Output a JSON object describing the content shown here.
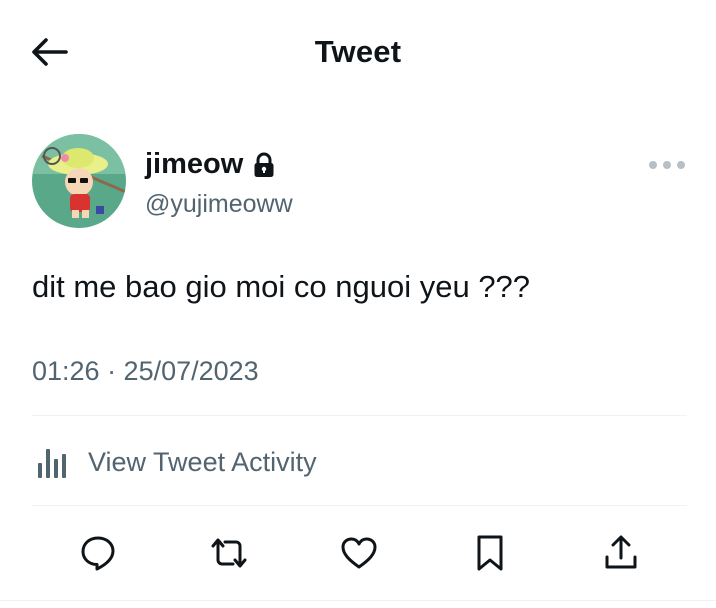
{
  "header": {
    "title": "Tweet",
    "back_icon": "arrow-left-icon"
  },
  "author": {
    "display_name": "jimeow",
    "handle": "@yujimeoww",
    "protected_icon": "lock-icon",
    "more_icon": "more-horizontal-icon"
  },
  "tweet": {
    "text": "dit me bao gio moi co nguoi yeu ???",
    "timestamp": "01:26 · 25/07/2023"
  },
  "activity": {
    "label": "View Tweet Activity",
    "icon": "bar-chart-icon"
  },
  "actions": [
    {
      "name": "reply",
      "icon": "reply-icon"
    },
    {
      "name": "retweet",
      "icon": "retweet-icon"
    },
    {
      "name": "like",
      "icon": "heart-icon"
    },
    {
      "name": "bookmark",
      "icon": "bookmark-icon"
    },
    {
      "name": "share",
      "icon": "share-icon"
    }
  ],
  "colors": {
    "text_primary": "#0f1419",
    "text_secondary": "#536471",
    "divider": "#eff3f4",
    "avatar_bg": "#5aa88a"
  }
}
